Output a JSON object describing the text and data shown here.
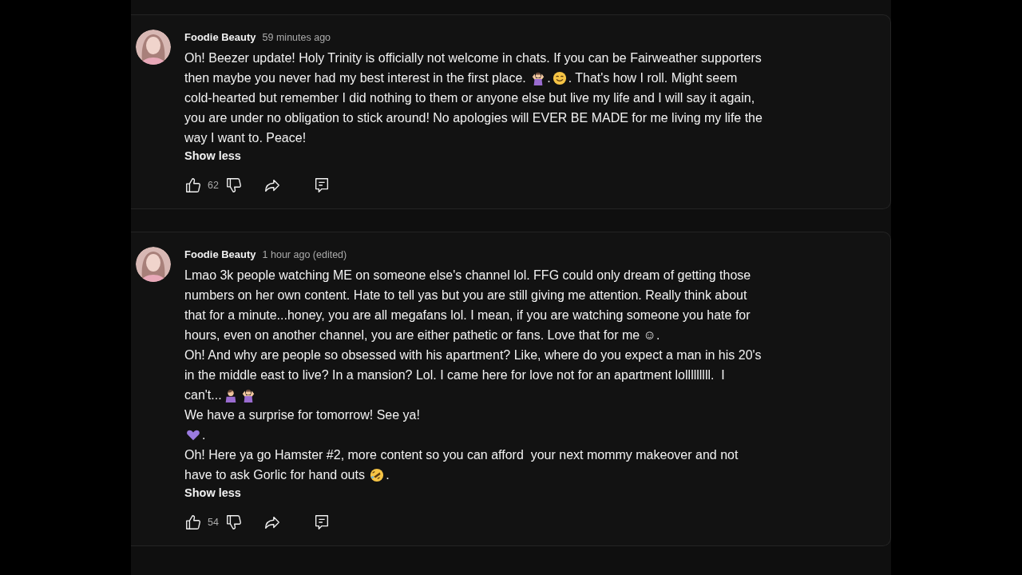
{
  "comments": [
    {
      "author": "Foodie Beauty",
      "time": "59 minutes ago",
      "toggle": "Show less",
      "likes": "62",
      "lines": [
        [
          {
            "kind": "text",
            "text": "Oh! Beezer update! Holy Trinity is officially not welcome in chats. If you can be Fairweather supporters"
          }
        ],
        [
          {
            "kind": "text",
            "text": "then maybe you never had my best interest in the first place. "
          },
          {
            "kind": "shrug"
          },
          {
            "kind": "text",
            "text": "."
          },
          {
            "kind": "smile"
          },
          {
            "kind": "text",
            "text": ". That's how I roll. Might seem"
          }
        ],
        [
          {
            "kind": "text",
            "text": "cold-hearted but remember I did nothing to them or anyone else but live my life and I will say it again,"
          }
        ],
        [
          {
            "kind": "text",
            "text": "you are under no obligation to stick around! No apologies will EVER BE MADE for me living my life the"
          }
        ],
        [
          {
            "kind": "text",
            "text": "way I want to. Peace!"
          }
        ]
      ]
    },
    {
      "author": "Foodie Beauty",
      "time": "1 hour ago (edited)",
      "toggle": "Show less",
      "likes": "54",
      "lines": [
        [
          {
            "kind": "text",
            "text": "Lmao 3k people watching ME on someone else's channel lol. FFG could only dream of getting those"
          }
        ],
        [
          {
            "kind": "text",
            "text": "numbers on her own content. Hate to tell yas but you are still giving me attention. Really think about"
          }
        ],
        [
          {
            "kind": "text",
            "text": "that for a minute...honey, you are all megafans lol. I mean, if you are watching someone you hate for"
          }
        ],
        [
          {
            "kind": "text",
            "text": "hours, even on another channel, you are either pathetic or fans. Love that for me ☺."
          }
        ],
        [
          {
            "kind": "text",
            "text": "Oh! And why are people so obsessed with his apartment? Like, where do you expect a man in his 20's"
          }
        ],
        [
          {
            "kind": "text",
            "text": "in the middle east to live? In a mansion? Lol. I came here for love not for an apartment lolllllllll.  I"
          }
        ],
        [
          {
            "kind": "text",
            "text": "can't..."
          },
          {
            "kind": "facepalm"
          },
          {
            "kind": "shrug"
          }
        ],
        [
          {
            "kind": "text",
            "text": "We have a surprise for tomorrow! See ya!"
          }
        ],
        [
          {
            "kind": "heart"
          },
          {
            "kind": "text",
            "text": "."
          }
        ],
        [
          {
            "kind": "text",
            "text": "Oh! Here ya go Hamster #2, more content so you can afford  your next mommy makeover and not"
          }
        ],
        [
          {
            "kind": "text",
            "text": "have to ask Gorlic for hand outs "
          },
          {
            "kind": "rofl"
          },
          {
            "kind": "text",
            "text": "."
          }
        ]
      ]
    }
  ]
}
